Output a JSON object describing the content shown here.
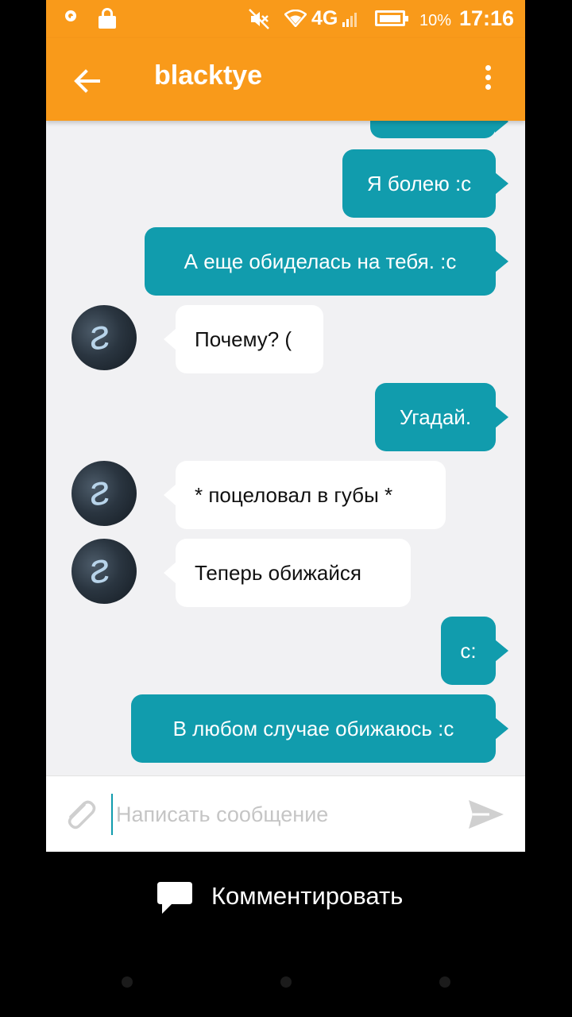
{
  "status_bar": {
    "network": "4G",
    "battery_percent": "10%",
    "time": "17:16",
    "icons": [
      "notification-circle-icon",
      "lock-icon",
      "mute-icon",
      "wifi-icon",
      "signal-icon",
      "battery-icon"
    ]
  },
  "app_bar": {
    "title": "blacktye",
    "icons": [
      "back-arrow-icon",
      "more-vertical-icon"
    ]
  },
  "messages": [
    {
      "direction": "outgoing",
      "text": ""
    },
    {
      "direction": "outgoing",
      "text": "Я болею :с"
    },
    {
      "direction": "outgoing",
      "text": "А еще обиделась на тебя. :с"
    },
    {
      "direction": "incoming",
      "text": "Почему? ("
    },
    {
      "direction": "outgoing",
      "text": "Угадай."
    },
    {
      "direction": "incoming",
      "text": "* поцеловал в губы *"
    },
    {
      "direction": "incoming",
      "text": "Теперь обижайся"
    },
    {
      "direction": "outgoing",
      "text": "с:"
    },
    {
      "direction": "outgoing",
      "text": "В любом случае обижаюсь :с"
    }
  ],
  "composer": {
    "placeholder": "Написать сообщение",
    "value": "",
    "icons": [
      "paperclip-icon",
      "send-icon"
    ]
  },
  "footer": {
    "comment_label": "Комментировать",
    "icon": "chat-bubble-icon"
  },
  "colors": {
    "accent_orange": "#f99a1a",
    "outgoing_bubble": "#119cad",
    "incoming_bubble": "#ffffff",
    "chat_background": "#f1f1f3"
  }
}
